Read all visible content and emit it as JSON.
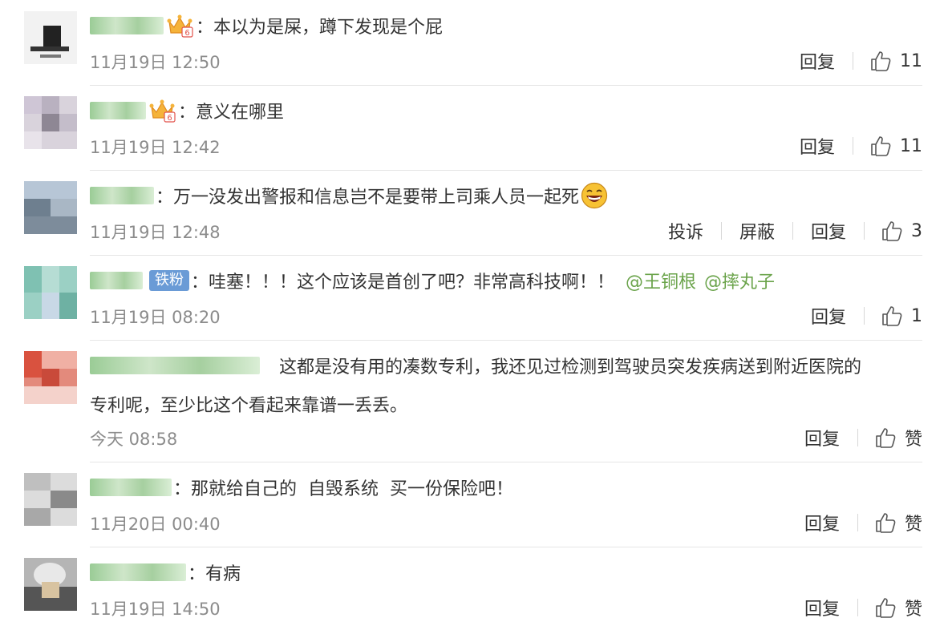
{
  "colors": {
    "text": "#333333",
    "meta": "#8c8c8c",
    "mention": "#6aa34a",
    "badge": "#6a9bd6",
    "divider": "#e6e6e6"
  },
  "comments": [
    {
      "text": "本以为是屎，蹲下发现是个屁",
      "time": "11月19日 12:50",
      "reply": "回复",
      "likes": "11",
      "badge": "crown-vip-icon"
    },
    {
      "text": "意义在哪里",
      "time": "11月19日 12:42",
      "reply": "回复",
      "likes": "11",
      "badge": "crown-vip-icon"
    },
    {
      "text": "万一没发出警报和信息岂不是要带上司乘人员一起死",
      "time": "11月19日 12:48",
      "report": "投诉",
      "block": "屏蔽",
      "reply": "回复",
      "likes": "3",
      "emoji": "laughing-emoji-icon"
    },
    {
      "badge_label": "铁粉",
      "text": "哇塞！！！这个应该是首创了吧？非常高科技啊！！",
      "mentions": [
        "@王铜根",
        "@摔丸子"
      ],
      "time": "11月19日 08:20",
      "reply": "回复",
      "likes": "1"
    },
    {
      "text": "这都是没有用的凑数专利，我还见过检测到驾驶员突发疾病送到附近医院的",
      "text2": "专利呢，至少比这个看起来靠谱一丢丢。",
      "time": "今天 08:58",
      "reply": "回复",
      "likes": "赞"
    },
    {
      "text": "那就给自己的  自毁系统  买一份保险吧！",
      "time": "11月20日 00:40",
      "reply": "回复",
      "likes": "赞"
    },
    {
      "text": "有病",
      "time": "11月19日 14:50",
      "reply": "回复",
      "likes": "赞"
    }
  ]
}
